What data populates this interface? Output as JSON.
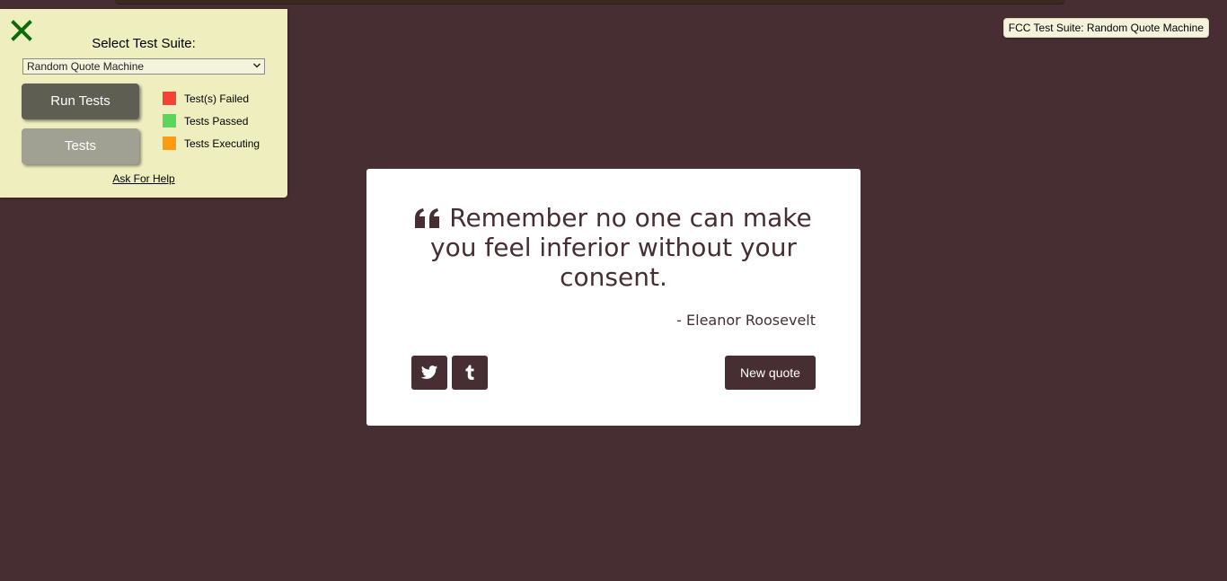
{
  "fcc": {
    "panel_title": "Select Test Suite:",
    "selected_suite": "Random Quote Machine",
    "run_button": "Run Tests",
    "tests_button": "Tests",
    "legend": [
      {
        "label": "Test(s) Failed",
        "color": "#f44336"
      },
      {
        "label": "Tests Passed",
        "color": "#5ad65a"
      },
      {
        "label": "Tests Executing",
        "color": "#ff9b10"
      }
    ],
    "help_link": "Ask For Help",
    "tag": "FCC Test Suite: Random Quote Machine",
    "close_icon": "close-x-icon"
  },
  "quote": {
    "text": "Remember no one can make you feel inferior without your consent.",
    "author": "- Eleanor Roosevelt",
    "new_quote_label": "New quote",
    "tweet_icon": "twitter-icon",
    "tumblr_icon": "tumblr-icon",
    "quote_icon": "quote-left-icon"
  },
  "colors": {
    "background": "#472e32",
    "panel": "#eeeebf",
    "accent": "#472e32"
  }
}
